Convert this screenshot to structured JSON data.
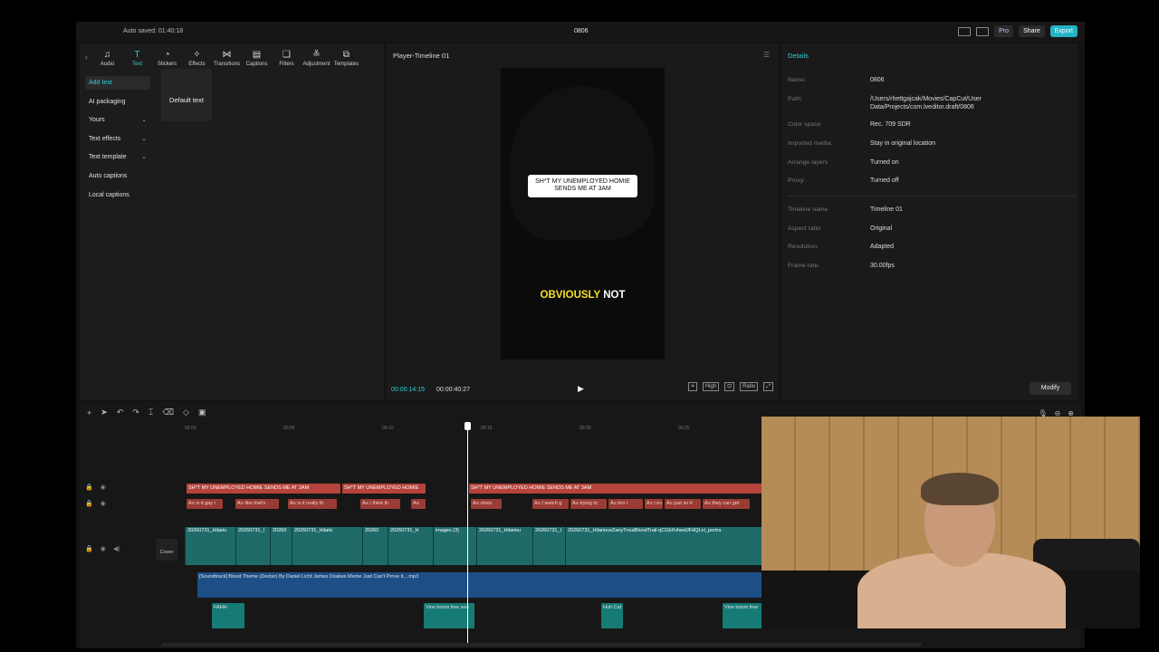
{
  "titlebar": {
    "autosave": "Auto saved: 01:40:18",
    "project": "0806",
    "pro": "Pro",
    "share": "Share",
    "export": "Export"
  },
  "toolbar": {
    "tools": [
      {
        "label": "Audio",
        "icon": "audio-icon"
      },
      {
        "label": "Text",
        "icon": "text-icon"
      },
      {
        "label": "Stickers",
        "icon": "sticker-icon"
      },
      {
        "label": "Effects",
        "icon": "effects-icon"
      },
      {
        "label": "Transitions",
        "icon": "transitions-icon"
      },
      {
        "label": "Captions",
        "icon": "captions-icon"
      },
      {
        "label": "Filters",
        "icon": "filters-icon"
      },
      {
        "label": "Adjustment",
        "icon": "adjustment-icon"
      },
      {
        "label": "Templates",
        "icon": "templates-icon"
      }
    ]
  },
  "sidebar": {
    "items": [
      {
        "label": "Add text"
      },
      {
        "label": "AI packaging"
      },
      {
        "label": "Yours"
      },
      {
        "label": "Text effects"
      },
      {
        "label": "Text template"
      },
      {
        "label": "Auto captions"
      },
      {
        "label": "Local captions"
      }
    ]
  },
  "media": {
    "card": "Default text"
  },
  "player": {
    "title": "Player-Timeline 01",
    "caption_top": "SH*T MY UNEMPLOYED HOMIE SENDS ME AT 3AM",
    "caption_bottom_1": "OBVIOUSLY",
    "caption_bottom_2": "NOT",
    "time_current": "00:00:14:15",
    "time_total": "00:00:40:27",
    "quality": "High",
    "ratio": "Ratio"
  },
  "details": {
    "heading": "Details",
    "rows": [
      {
        "label": "Name:",
        "value": "0806"
      },
      {
        "label": "Path:",
        "value": "/Users/rhettgajcak/Movies/CapCut/User Data/Projects/com.lveditor.draft/0806"
      },
      {
        "label": "Color space",
        "value": "Rec. 709 SDR"
      },
      {
        "label": "Imported media:",
        "value": "Stay in original location"
      },
      {
        "label": "Arrange layers",
        "value": "Turned on"
      },
      {
        "label": "Proxy:",
        "value": "Turned off"
      },
      {
        "label": "Timeline name",
        "value": "Timeline 01"
      },
      {
        "label": "Aspect ratio:",
        "value": "Original"
      },
      {
        "label": "Resolution:",
        "value": "Adapted"
      },
      {
        "label": "Frame rate:",
        "value": "30.00fps"
      }
    ],
    "modify": "Modify"
  },
  "timeline": {
    "ruler": [
      "00:00",
      "00:05",
      "00:10",
      "00:15",
      "00:20",
      "00:25"
    ],
    "title_clips": [
      "SH*T MY UNEMPLOYED HOMIE SENDS ME AT 3AM",
      "SH*T MY UNEMPLOYED HOMIE",
      "SH*T MY UNEMPLOYED HOMIE SENDS ME AT 3AM"
    ],
    "sub_clips": [
      "A≡ is it gay i",
      "A≡ like that's",
      "A≡ is it really th",
      "A≡ I think th",
      "A≡",
      "A≡ obvio",
      "A≡ I watch g",
      "A≡ trying to",
      "A≡ bro i",
      "A≡ i ev",
      "A≡ just so tl",
      "A≡ they can get"
    ],
    "video_clips": [
      "20260731_Hilario",
      "20260731_I",
      "20260",
      "20260731_Hilaric",
      "20260",
      "20260731_H",
      "images (3)",
      "20260731_Hilariou",
      "20260731_I",
      "20260731_HilariousZanyTroutBloodTrail-qCGbXvhwdJFdQLnl_portra"
    ],
    "cover": "Cover",
    "audio_clip": "[Soundtrack]  Blood Theme  (Dexter) By Daniel Licht James Doakes  Meme Just Can't Prove it....mp3",
    "sfx_clips": [
      "FAHH",
      "Vine boom free sou",
      "Huh Cat",
      "Vine boom free"
    ]
  }
}
